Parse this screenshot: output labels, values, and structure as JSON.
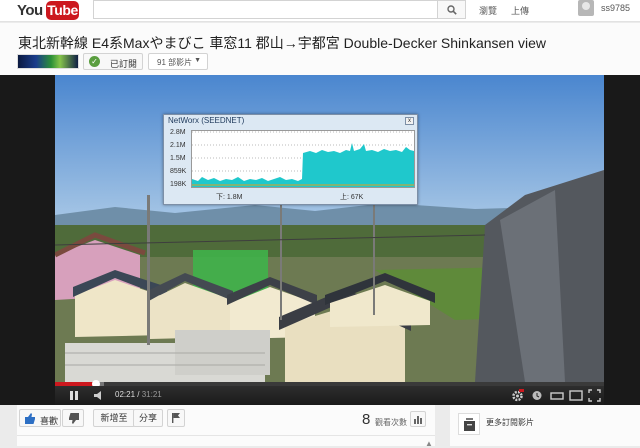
{
  "topbar": {
    "logo_you": "You",
    "logo_tube": "Tube",
    "search_value": "",
    "browse_label": "瀏覽",
    "upload_label": "上傳",
    "username": "ss9785"
  },
  "video_header": {
    "title": "東北新幹線 E4系Maxやまびこ 車窓11 郡山→宇都宮 Double-Decker Shinkansen view",
    "subscribed_label": "已訂閱",
    "subscriber_count": "91 部影片"
  },
  "networx": {
    "title": "NetWorx (SEEDNET)",
    "close_glyph": "x",
    "y_labels": [
      "2.8M",
      "2.1M",
      "1.5M",
      "859K",
      "198K"
    ],
    "download_label": "下: 1.8M",
    "upload_label": "上: 67K",
    "traffic_color": "#1fc8cc"
  },
  "player": {
    "current_time": "02:21",
    "duration": "31:21",
    "progress_fraction": 0.075,
    "buffered_fraction": 0.09,
    "progress_color": "#cc181e"
  },
  "actions": {
    "like_label": "喜歡",
    "add_to_label": "新增至",
    "share_label": "分享",
    "view_count": "8",
    "view_label": "觀看次數",
    "collapse_glyph": "▲"
  },
  "sidebar": {
    "more_label": "更多訂閱影片"
  }
}
